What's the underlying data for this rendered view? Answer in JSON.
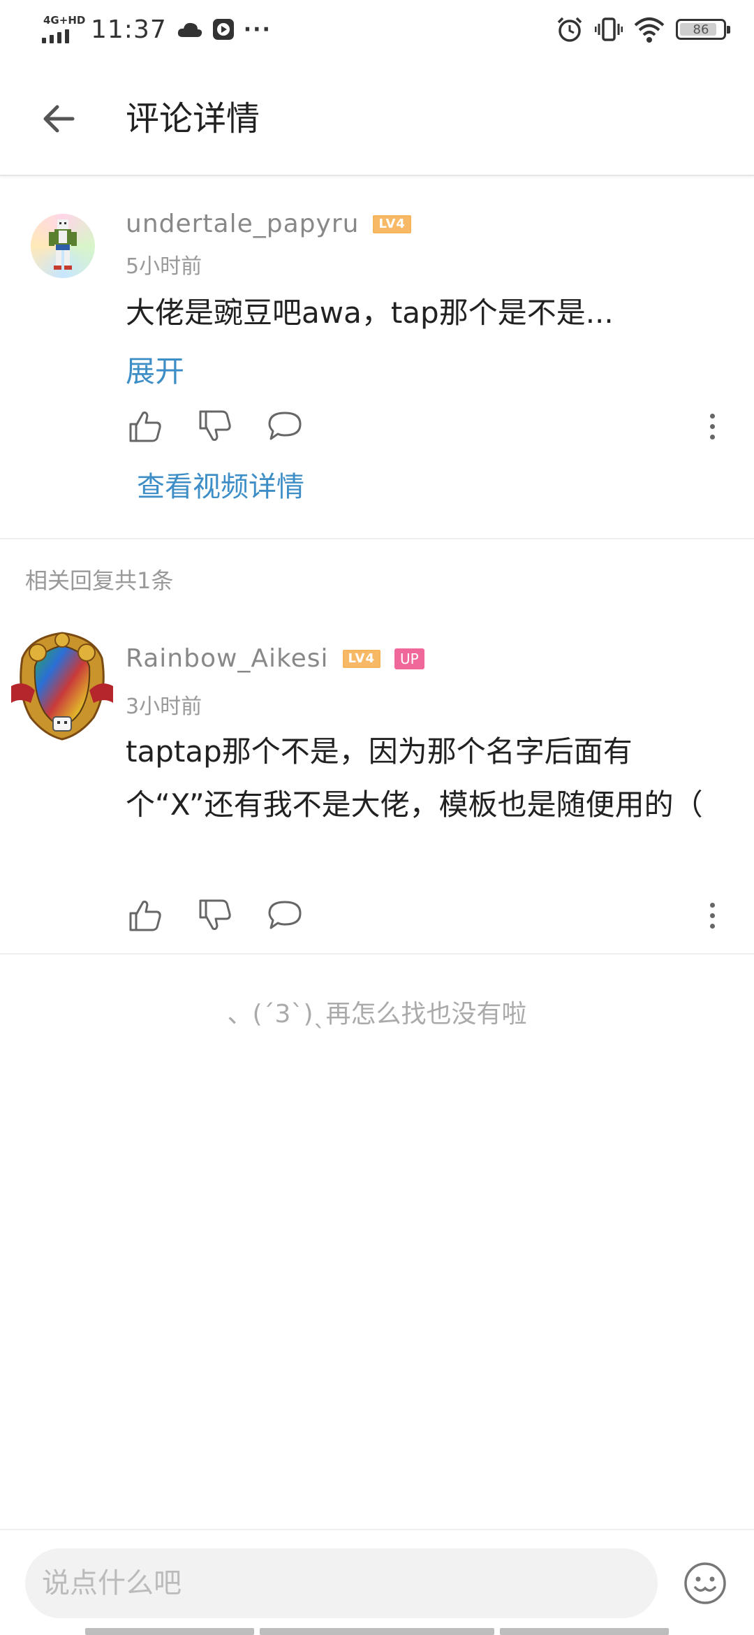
{
  "status_bar": {
    "network": "4G+HD",
    "time": "11:37",
    "more": "···",
    "battery": "86",
    "battery_level": 0.86
  },
  "toolbar": {
    "title": "评论详情"
  },
  "main_comment": {
    "username": "undertale_papyru",
    "level_badge": "LV4",
    "time": "5小时前",
    "content": "大佬是豌豆吧awa，tap那个是不是...",
    "expand_label": "展开",
    "view_video_label": "查看视频详情"
  },
  "replies_header": "相关回复共1条",
  "reply": {
    "username": "Rainbow_Aikesi",
    "level_badge": "LV4",
    "up_badge": "UP",
    "time": "3小时前",
    "content": "taptap那个不是，因为那个名字后面有个“X”还有我不是大佬，模板也是随便用的（"
  },
  "end_message": "、(ˊ3ˋ)ˎ再怎么找也没有啦",
  "input_bar": {
    "placeholder": "说点什么吧"
  },
  "icons": {
    "back": "arrow-left-icon",
    "like": "thumbs-up-icon",
    "dislike": "thumbs-down-icon",
    "reply": "comment-bubble-icon",
    "more": "more-vertical-icon",
    "emoji": "emoji-face-icon"
  },
  "colors": {
    "link": "#3d8ec6",
    "level_badge": "#f8b967",
    "up_badge": "#f0679a"
  }
}
